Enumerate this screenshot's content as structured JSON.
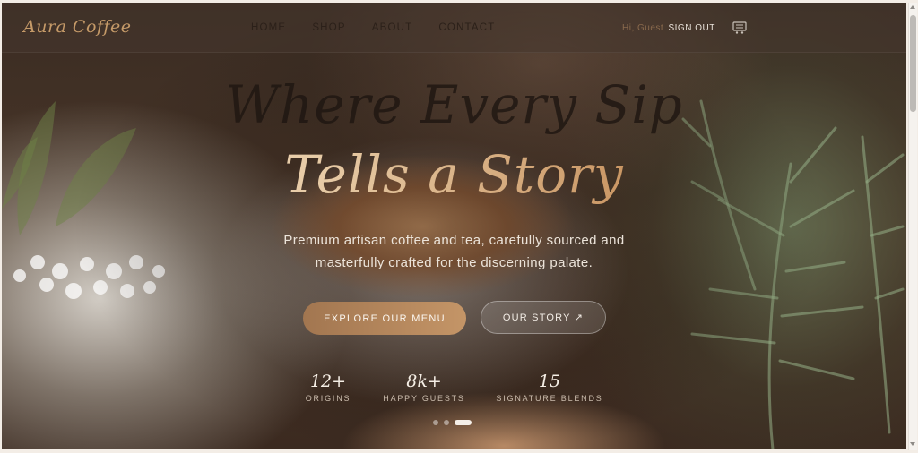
{
  "nav": {
    "logo": "Aura Coffee",
    "links": [
      "HOME",
      "SHOP",
      "ABOUT",
      "CONTACT"
    ],
    "greeting": "Hi, Guest",
    "sign_out": "SIGN OUT",
    "cart_icon": "cart-icon"
  },
  "hero": {
    "title_line1": "Where Every Sip",
    "title_line2": "Tells a Story",
    "subtitle_line1": "Premium artisan coffee and tea, carefully sourced and",
    "subtitle_line2": "masterfully crafted for the discerning palate.",
    "primary_button": "EXPLORE OUR MENU",
    "secondary_button": "OUR STORY ↗",
    "stats": [
      {
        "value": "12+",
        "label": "ORIGINS"
      },
      {
        "value": "8k+",
        "label": "HAPPY GUESTS"
      },
      {
        "value": "15",
        "label": "SIGNATURE BLENDS"
      }
    ],
    "carousel": {
      "slides": 3,
      "active_index": 2
    }
  },
  "colors": {
    "accent": "#c49567",
    "logo": "#c59a68",
    "nav_text": "#2b2019"
  }
}
